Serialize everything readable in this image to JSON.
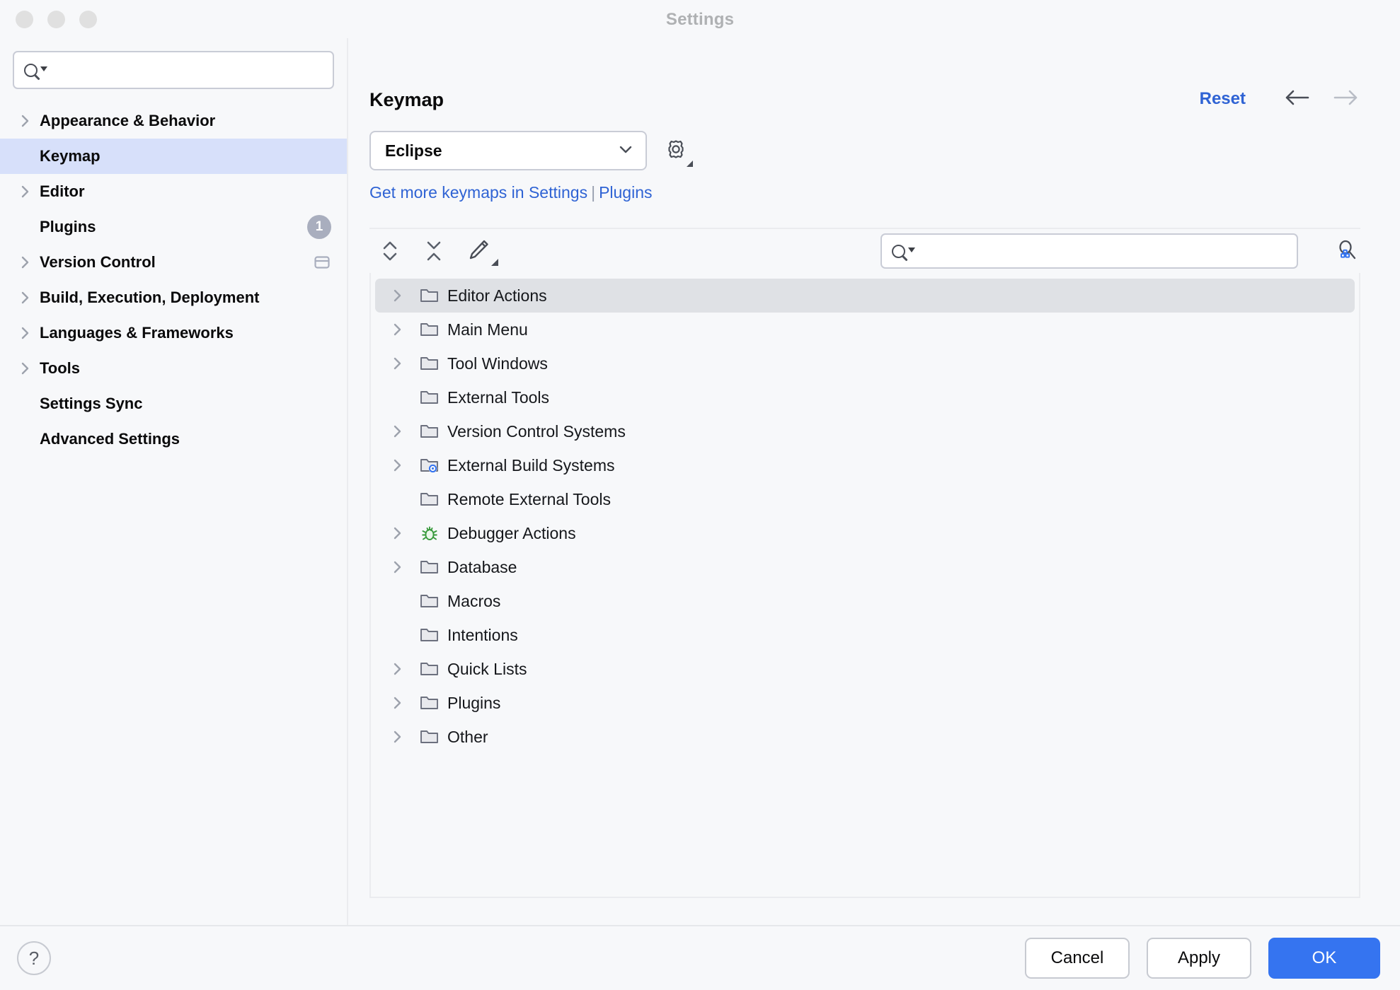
{
  "window": {
    "title": "Settings",
    "traffic_lights": [
      "close",
      "minimize",
      "zoom"
    ]
  },
  "sidebar": {
    "search": {
      "value": "",
      "placeholder": ""
    },
    "items": [
      {
        "label": "Appearance & Behavior",
        "expandable": true,
        "selected": false,
        "badge": null
      },
      {
        "label": "Keymap",
        "expandable": false,
        "selected": true,
        "badge": null
      },
      {
        "label": "Editor",
        "expandable": true,
        "selected": false,
        "badge": null
      },
      {
        "label": "Plugins",
        "expandable": false,
        "selected": false,
        "badge": "1"
      },
      {
        "label": "Version Control",
        "expandable": true,
        "selected": false,
        "badge": null
      },
      {
        "label": "Build, Execution, Deployment",
        "expandable": true,
        "selected": false,
        "badge": null
      },
      {
        "label": "Languages & Frameworks",
        "expandable": true,
        "selected": false,
        "badge": null
      },
      {
        "label": "Tools",
        "expandable": true,
        "selected": false,
        "badge": null
      },
      {
        "label": "Settings Sync",
        "expandable": false,
        "selected": false,
        "badge": null
      },
      {
        "label": "Advanced Settings",
        "expandable": false,
        "selected": false,
        "badge": null
      }
    ]
  },
  "main": {
    "page_title": "Keymap",
    "reset_label": "Reset",
    "back_arrow": "arrow-left-icon",
    "forward_arrow": "arrow-right-icon",
    "keymap_select": {
      "value": "Eclipse",
      "options": [
        "Eclipse"
      ]
    },
    "gear_label": "gear-icon",
    "more_keymaps": {
      "prefix": "Get more keymaps in Settings",
      "separator": "|",
      "suffix": "Plugins"
    },
    "toolbar": {
      "expand_all": "expand-all-icon",
      "collapse_all": "collapse-all-icon",
      "edit": "edit-pencil-icon",
      "find_by_shortcut": "find-by-shortcut-icon",
      "search": {
        "value": "",
        "placeholder": ""
      }
    },
    "tree": [
      {
        "label": "Editor Actions",
        "expandable": true,
        "selected": true,
        "icon": "folder-icon"
      },
      {
        "label": "Main Menu",
        "expandable": true,
        "selected": false,
        "icon": "folder-icon"
      },
      {
        "label": "Tool Windows",
        "expandable": true,
        "selected": false,
        "icon": "folder-icon"
      },
      {
        "label": "External Tools",
        "expandable": false,
        "selected": false,
        "icon": "folder-icon"
      },
      {
        "label": "Version Control Systems",
        "expandable": true,
        "selected": false,
        "icon": "folder-icon"
      },
      {
        "label": "External Build Systems",
        "expandable": true,
        "selected": false,
        "icon": "folder-gear-icon"
      },
      {
        "label": "Remote External Tools",
        "expandable": false,
        "selected": false,
        "icon": "folder-icon"
      },
      {
        "label": "Debugger Actions",
        "expandable": true,
        "selected": false,
        "icon": "bug-icon"
      },
      {
        "label": "Database",
        "expandable": true,
        "selected": false,
        "icon": "folder-icon"
      },
      {
        "label": "Macros",
        "expandable": false,
        "selected": false,
        "icon": "folder-icon"
      },
      {
        "label": "Intentions",
        "expandable": false,
        "selected": false,
        "icon": "folder-icon"
      },
      {
        "label": "Quick Lists",
        "expandable": true,
        "selected": false,
        "icon": "folder-icon"
      },
      {
        "label": "Plugins",
        "expandable": true,
        "selected": false,
        "icon": "folder-icon"
      },
      {
        "label": "Other",
        "expandable": true,
        "selected": false,
        "icon": "folder-icon"
      }
    ]
  },
  "footer": {
    "help_label": "?",
    "cancel_label": "Cancel",
    "apply_label": "Apply",
    "ok_label": "OK"
  },
  "colors": {
    "accent_blue": "#3574F0",
    "link_blue": "#2F63D4",
    "selection_lavender": "#D7E0FA",
    "tree_selection_grey": "#DFE1E5",
    "background": "#F7F8FA",
    "debugger_green": "#389A3C",
    "gear_overlay_blue": "#3574F0"
  }
}
